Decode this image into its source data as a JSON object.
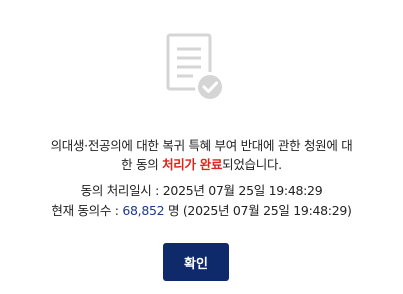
{
  "icon": "document-check-icon",
  "message": {
    "line1": "의대생·전공의에 대한 복귀 특혜 부여 반대에 관한 청원에 대",
    "line2_prefix": "한 동의 ",
    "line2_highlight": "처리가 완료",
    "line2_suffix": "되었습니다."
  },
  "info": {
    "processed_label": "동의 처리일시 : ",
    "processed_datetime": "2025년 07월 25일 19:48:29",
    "count_label": "현재 동의수 : ",
    "count_value": "68,852",
    "count_unit": " 명 ",
    "count_datetime": "(2025년 07월 25일 19:48:29)"
  },
  "confirm_button": {
    "label": "확인"
  },
  "colors": {
    "highlight": "#e0231c",
    "count": "#1a3a8c",
    "button_bg": "#0f2a6b",
    "icon_gray": "#d5d5d5"
  }
}
